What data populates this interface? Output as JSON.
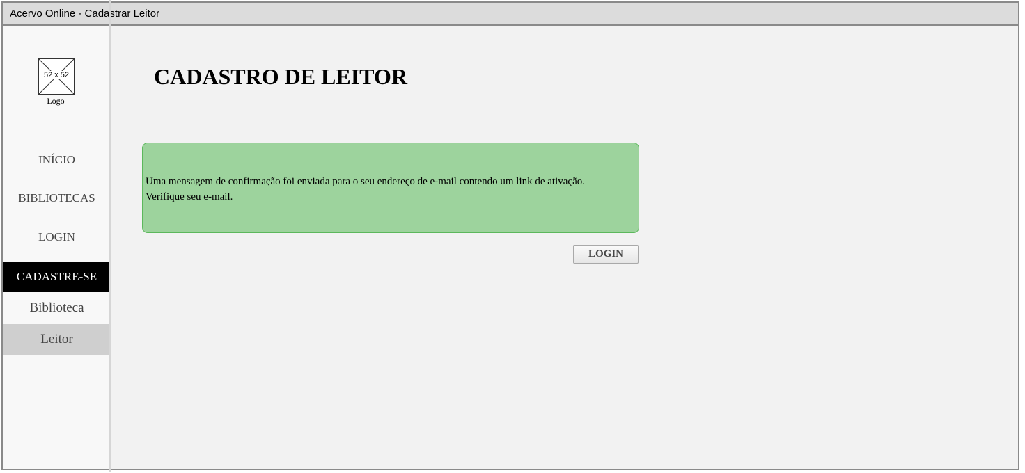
{
  "window": {
    "title": "Acervo Online - Cadastrar Leitor"
  },
  "sidebar": {
    "logo": {
      "placeholder_size": "52 x 52",
      "caption": "Logo"
    },
    "nav": [
      {
        "label": "INÍCIO"
      },
      {
        "label": "BIBLIOTECAS"
      },
      {
        "label": "LOGIN"
      },
      {
        "label": "CADASTRE-SE",
        "active": true
      }
    ],
    "sub_nav": [
      {
        "label": "Biblioteca"
      },
      {
        "label": "Leitor",
        "selected": true
      }
    ]
  },
  "main": {
    "title": "CADASTRO DE LEITOR",
    "alert": {
      "line1": "Uma mensagem de confirmação foi enviada para o seu endereço de e-mail contendo um link de ativação.",
      "line2": "Verifique seu e-mail."
    },
    "login_button": "LOGIN"
  },
  "colors": {
    "alert_background": "#9dd39d",
    "alert_border": "#5cb85c",
    "active_nav_background": "#000000",
    "selected_sub_background": "#cfcfcf",
    "content_background": "#f2f2f2",
    "sidebar_background": "#f8f8f8"
  }
}
